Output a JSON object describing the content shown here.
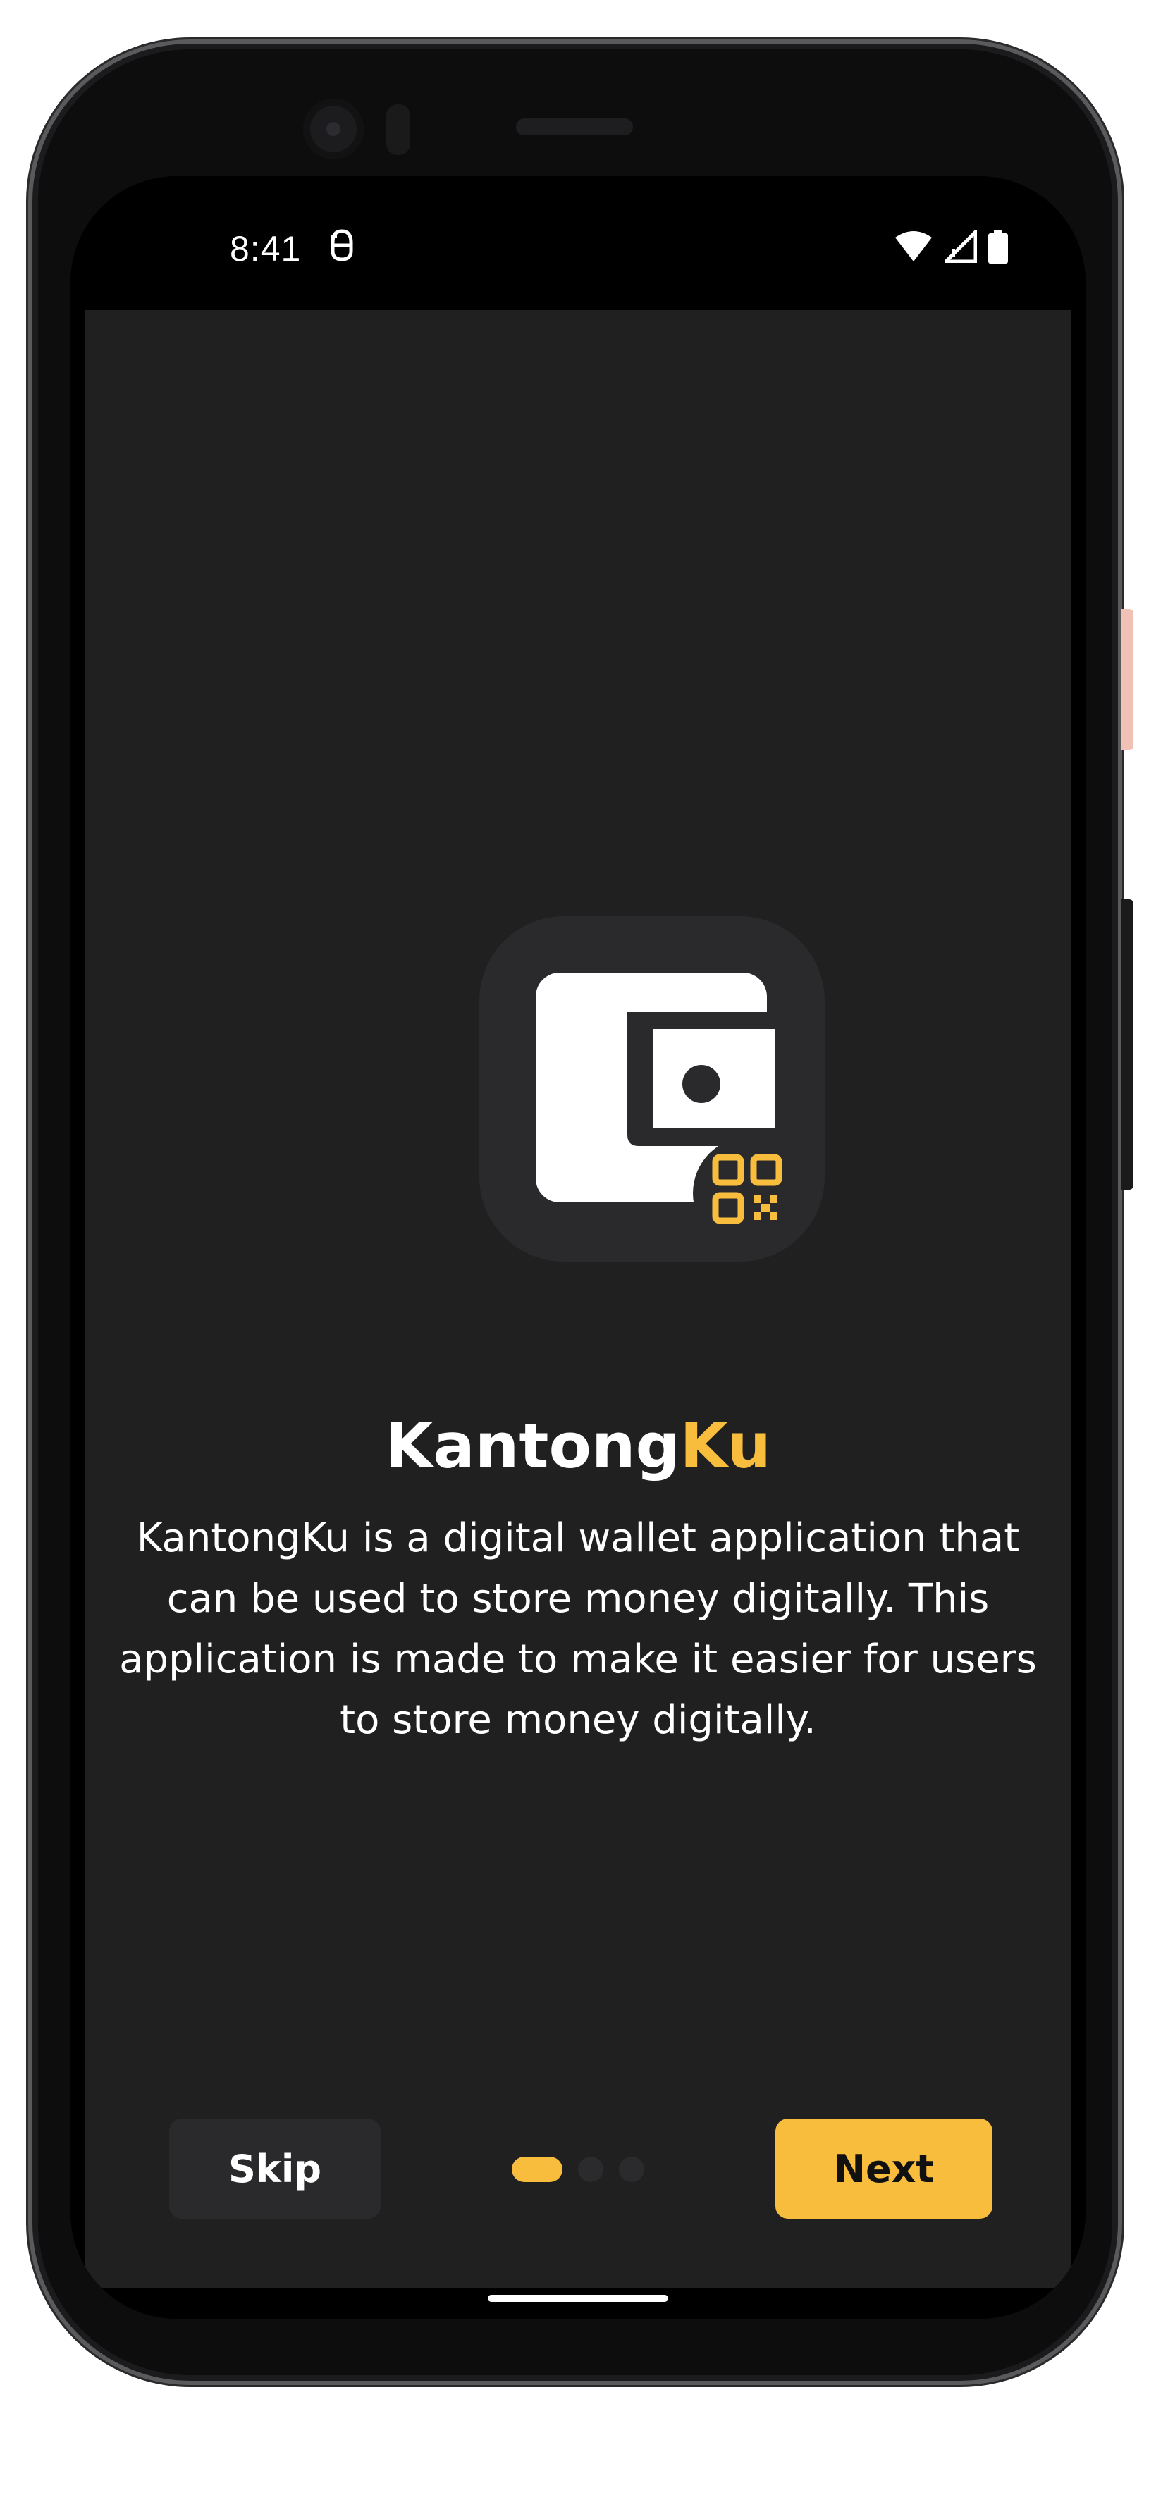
{
  "status_bar": {
    "time": "8:41",
    "left_icon": "assistant-face-icon",
    "right_icons": [
      "wifi-icon",
      "signal-icon",
      "battery-icon"
    ]
  },
  "logo": {
    "icon": "wallet-qr-icon"
  },
  "app_name": {
    "primary": "Kantong",
    "accent": "Ku"
  },
  "description": "KantongKu is a digital wallet application that can be used to store money digitally. This application is made to make it easier for users to store money digitally.",
  "footer": {
    "skip_label": "Skip",
    "next_label": "Next",
    "pagination": {
      "total": 3,
      "current": 1
    }
  },
  "colors": {
    "accent": "#f9bd3e",
    "background": "#202021",
    "surface": "#2a2a2c",
    "text": "#ffffff"
  }
}
